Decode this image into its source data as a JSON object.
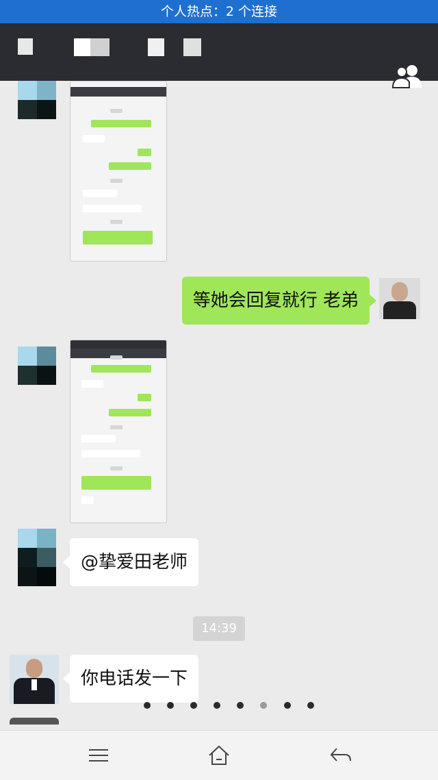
{
  "status": {
    "hotspot_text": "个人热点：2 个连接"
  },
  "header": {
    "title_obscured": true,
    "contacts_icon": "group-icon"
  },
  "chat": {
    "messages": [
      {
        "side": "left",
        "type": "image",
        "description_label": ""
      },
      {
        "side": "right",
        "type": "text",
        "text": "等她会回复就行 老弟"
      },
      {
        "side": "left",
        "type": "image"
      },
      {
        "side": "left",
        "type": "text",
        "text": "@挚爱田老师"
      },
      {
        "type": "time",
        "text": "14:39"
      },
      {
        "side": "left",
        "type": "text",
        "text": "你电话发一下"
      }
    ]
  },
  "pager": {
    "count": 8,
    "active_index": 5
  },
  "navbar": {
    "icons": [
      "menu-icon",
      "home-icon",
      "back-icon"
    ]
  }
}
